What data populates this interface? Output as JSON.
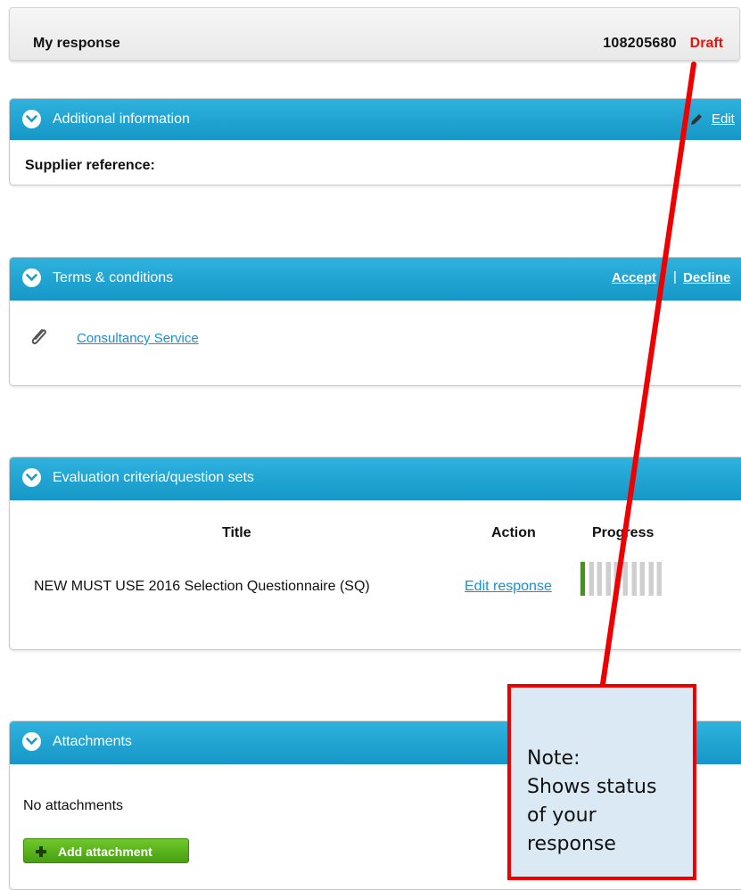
{
  "header": {
    "title": "My response",
    "response_id": "108205680",
    "status": "Draft",
    "status_color": "#e8140f"
  },
  "additional_info": {
    "title": "Additional information",
    "edit_label": "Edit",
    "supplier_reference_label": "Supplier reference:"
  },
  "terms": {
    "title": "Terms & conditions",
    "accept_label": "Accept",
    "separator": "|",
    "decline_label": "Decline",
    "document_link": "Consultancy Service",
    "document_icon": "paperclip-icon"
  },
  "evaluation": {
    "title": "Evaluation criteria/question sets",
    "columns": [
      "Title",
      "Action",
      "Progress"
    ],
    "rows": [
      {
        "title": "NEW MUST USE 2016 Selection Questionnaire (SQ)",
        "action": "Edit response",
        "progress_filled_segments": 1,
        "progress_total_segments": 10
      }
    ]
  },
  "attachments": {
    "title": "Attachments",
    "empty_text": "No attachments",
    "add_button_label": "Add attachment",
    "add_icon": "plus-icon"
  },
  "annotation": {
    "note_lines": [
      "Note:",
      "Shows status",
      "of your",
      "response"
    ],
    "color": "#ee0000"
  },
  "colors": {
    "panel_header": "#1fa3d3",
    "link": "#1a8fd1",
    "progress_filled": "#3d9a0f",
    "progress_empty": "#cfcfcf",
    "add_button": "#56b01a"
  }
}
